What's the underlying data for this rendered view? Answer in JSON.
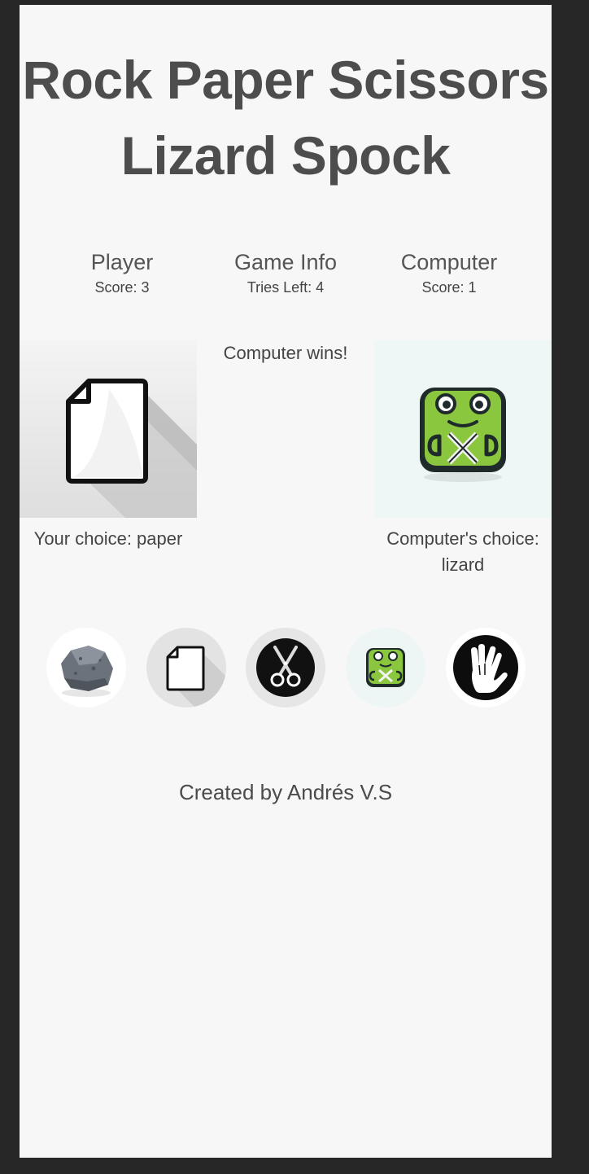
{
  "title": {
    "line1": "Rock Paper Scissors",
    "line2": "Lizard Spock"
  },
  "player": {
    "heading": "Player",
    "score_label": "Score: 3"
  },
  "game_info": {
    "heading": "Game Info",
    "tries_label": "Tries Left: 4",
    "result": "Computer wins!"
  },
  "computer": {
    "heading": "Computer",
    "score_label": "Score: 1"
  },
  "choices": {
    "player_caption": "Your choice: paper",
    "player_icon": "paper-icon",
    "computer_caption_line1": "Computer's choice:",
    "computer_caption_line2": "lizard",
    "computer_icon": "lizard-icon"
  },
  "options": [
    {
      "name": "rock",
      "icon": "rock-icon"
    },
    {
      "name": "paper",
      "icon": "paper-icon"
    },
    {
      "name": "scissors",
      "icon": "scissors-icon"
    },
    {
      "name": "lizard",
      "icon": "lizard-icon"
    },
    {
      "name": "spock",
      "icon": "spock-hand-icon"
    }
  ],
  "footer": {
    "credit": "Created by Andrés V.S"
  },
  "colors": {
    "page_background": "#f7f7f7",
    "outer_background": "#272727",
    "text": "#4b4b4b",
    "lizard_green": "#8bc63f"
  }
}
